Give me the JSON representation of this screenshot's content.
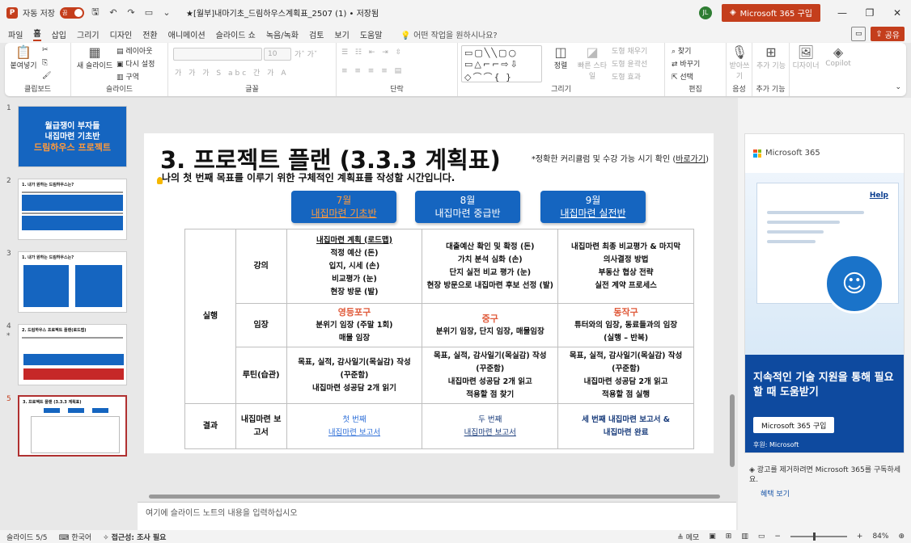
{
  "titlebar": {
    "autosave_label": "자동 저장",
    "autosave_state": "끔",
    "doc_title": "★[월부]내마기초_드림하우스계획표_2507 (1) • 저장됨",
    "avatar": "JL",
    "m365_button": "Microsoft 365 구입"
  },
  "menu": {
    "items": [
      "파일",
      "홈",
      "삽입",
      "그리기",
      "디자인",
      "전환",
      "애니메이션",
      "슬라이드 쇼",
      "녹음/녹화",
      "검토",
      "보기",
      "도움말"
    ],
    "active": "홈",
    "tellme": "어떤 작업을 원하시나요?",
    "share": "공유"
  },
  "ribbon": {
    "groups": [
      "클립보드",
      "슬라이드",
      "글꼴",
      "단락",
      "그리기",
      "편집",
      "음성",
      "추가 기능"
    ],
    "paste": "붙여넣기",
    "new_slide": "새 슬라이드",
    "layout": "레이아웃",
    "reset": "다시 설정",
    "section": "구역",
    "font_size": "10",
    "arrange": "정렬",
    "quick_style": "빠른 스타일",
    "shape_fill": "도형 채우기",
    "shape_outline": "도형 윤곽선",
    "shape_effect": "도형 효과",
    "find": "찾기",
    "replace": "바꾸기",
    "select": "선택",
    "dictate": "받아쓰기",
    "addins": "추가 기능",
    "designer": "디자이너",
    "copilot": "Copilot"
  },
  "thumbnails": {
    "numbers": [
      "1",
      "2",
      "3",
      "4",
      "5"
    ],
    "slide1_lines": [
      "월급쟁이 부자들",
      "내집마련 기초반",
      "드림하우스 프로젝트"
    ],
    "slide2_title": "1. 내가 원하는 드림하우스는?",
    "slide3_title": "1. 내가 원하는 드림하우스는?",
    "slide4_title": "2. 드림하우스 프로젝트 플랜(로드맵)",
    "slide5_title": "3. 프로젝트 플랜 (3.3.3 계획표)"
  },
  "slide": {
    "title": "3. 프로젝트 플랜 (3.3.3 계획표)",
    "note_prefix": "*정확한 커리큘럼 및 수강 가능 시기 확인 (",
    "note_link": "바로가기",
    "note_suffix": ")",
    "subtitle": "나의 첫 번째 목표를 이루기 위한 구체적인 계획표를 작성할 시간입니다.",
    "months": [
      {
        "month": "7월",
        "title": "내집마련 기초반",
        "highlight": true
      },
      {
        "month": "8월",
        "title": "내집마련 중급반",
        "highlight": false
      },
      {
        "month": "9월",
        "title": "내집마련 실전반",
        "highlight": false
      }
    ],
    "table": {
      "execution": "실행",
      "result": "결과",
      "lecture": "강의",
      "field": "임장",
      "routine": "루틴(습관)",
      "report": "내집마련 보고서",
      "lecture_col1": [
        "내집마련 계획 (로드맵)",
        "적정 예산 (돈)",
        "입지, 시세 (손)",
        "비교평가 (눈)",
        "현장 방문 (발)"
      ],
      "lecture_col2": [
        "대출예산 확인 및 확정 (돈)",
        "가치 분석 심화 (손)",
        "단지 실전 비교 평가 (눈)",
        "현장 방문으로 내집마련 후보 선정 (발)"
      ],
      "lecture_col3": [
        "내집마련 최종 비교평가 & 마지막",
        "의사결정 방법",
        "부동산 협상 전략",
        "실전 계약 프로세스"
      ],
      "field_col1_region": "영등포구",
      "field_col1": [
        "분위기 임장 (주말 1회)",
        "매물 임장"
      ],
      "field_col2_region": "중구",
      "field_col2": [
        "분위기 임장, 단지 임장, 매물임장"
      ],
      "field_col3_region": "동작구",
      "field_col3": [
        "튜터와의 임장, 동료들과의 임장",
        "(실행 – 반복)"
      ],
      "routine_col1": [
        "목표, 실적, 감사일기(목실감) 작성",
        "(꾸준함)",
        "내집마련 성공담 2개 읽기"
      ],
      "routine_col2": [
        "목표, 실적, 감사일기(목실감) 작성",
        "(꾸준함)",
        "내집마련 성공담 2개 읽고",
        "적용할 점 찾기"
      ],
      "routine_col3": [
        "목표, 실적, 감사일기(목실감) 작성",
        "(꾸준함)",
        "내집마련 성공담 2개 읽고",
        "적용할 점 실행"
      ],
      "report_col1": [
        "첫 번째",
        "내집마련 보고서"
      ],
      "report_col2": [
        "두 번째",
        "내집마련 보고서"
      ],
      "report_col3": [
        "세 번째 내집마련 보고서 &",
        "내집마련 완료"
      ]
    }
  },
  "notes_placeholder": "여기에 슬라이드 노트의 내용을 입력하십시오",
  "ad": {
    "brand": "Microsoft 365",
    "help": "Help",
    "headline": "지속적인 기술 지원을 통해 필요할 때 도움받기",
    "button": "Microsoft 365 구입",
    "sponsor": "후원: Microsoft",
    "footer": "광고를 제거하려면 Microsoft 365를 구독하세요.",
    "footer_link": "혜택 보기"
  },
  "statusbar": {
    "slide_count": "슬라이드 5/5",
    "language": "한국어",
    "accessibility": "접근성: 조사 필요",
    "notes": "메모",
    "zoom": "84%"
  },
  "colors": {
    "accent": "#c43e1c",
    "slide_blue": "#1565c0",
    "highlight_orange": "#ff9a3c",
    "region_red": "#e05a3a"
  }
}
